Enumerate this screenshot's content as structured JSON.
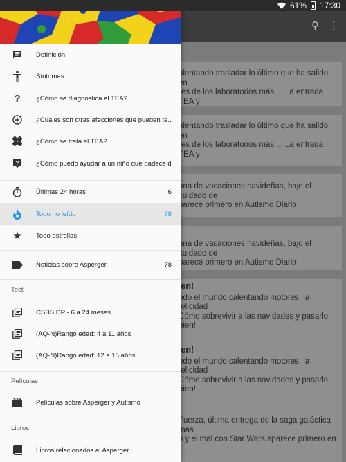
{
  "status": {
    "battery": "61%",
    "time": "17:30"
  },
  "drawer": {
    "items_top": [
      {
        "label": "Definición",
        "icon": "message-icon"
      },
      {
        "label": "Síntomas",
        "icon": "person-icon"
      },
      {
        "label": "¿Cómo se diagnostica el TEA?",
        "icon": "question-icon"
      },
      {
        "label": "¿Cuáles son otras afecciones que pueden te...",
        "icon": "add-circle-icon"
      },
      {
        "label": "¿Cómo se trata el TEA?",
        "icon": "bandage-icon"
      },
      {
        "label": "¿Cómo puedo ayudar a un niño que padece d...",
        "icon": "help-box-icon"
      }
    ],
    "items_filters": [
      {
        "label": "Últimas 24 horas",
        "count": "6",
        "icon": "timer-icon"
      },
      {
        "label": "Todo no leído",
        "count": "78",
        "icon": "flame-icon"
      },
      {
        "label": "Todo estrellas",
        "count": "",
        "icon": "star-icon"
      }
    ],
    "items_news": [
      {
        "label": "Noticias sobre Asperger",
        "count": "78",
        "icon": "label-icon"
      }
    ],
    "section_test": "Test",
    "items_test": [
      {
        "label": "CSBS DP - 6 a 24 meses",
        "icon": "library-icon"
      },
      {
        "label": "(AQ-N)Rango edad: 4 a 11 años",
        "icon": "library-icon"
      },
      {
        "label": "(AQ-N)Rango edad: 12 a 15 años",
        "icon": "library-icon"
      }
    ],
    "section_movies": "Películas",
    "items_movies": [
      {
        "label": "Películas sobre Asperger y Autismo",
        "icon": "movie-icon"
      }
    ],
    "section_books": "Libros",
    "items_books": [
      {
        "label": "Libros relacionados al Asperger",
        "icon": "book-icon"
      }
    ]
  },
  "background": {
    "cards": [
      {
        "title": "",
        "lines": [
          "alentando trasladar lo último que ha salido en",
          "res de los laboratorios más ... La entrada TEA y"
        ]
      },
      {
        "title": "",
        "lines": [
          "alentando trasladar lo último que ha salido en",
          "res de los laboratorios más ... La entrada TEA y"
        ]
      },
      {
        "title": "",
        "lines": [
          "ana de vacaciones navideñas, bajo el cuidado de",
          "parece primero en Autismo Diario ."
        ]
      },
      {
        "title": "",
        "lines": [
          "ana de vacaciones navideñas, bajo el cuidado de",
          "parece primero en Autismo Diario ."
        ]
      },
      {
        "title": "ien!",
        "lines": [
          "odo el mundo calentando motores, la felicidad",
          "Cómo sobrevivir a las navidades y pasarlo bien!"
        ]
      },
      {
        "title": "ien!",
        "lines": [
          "odo el mundo calentando motores, la felicidad",
          "Cómo sobrevivir a las navidades y pasarlo bien!"
        ]
      },
      {
        "title": "",
        "lines": [
          "Fuerza, última entrega de la saga galáctica más",
          "n y el mal con Star Wars aparece primero en"
        ]
      }
    ]
  },
  "colors": {
    "accent": "#2196f3",
    "active_bg": "#e6e6e6"
  }
}
